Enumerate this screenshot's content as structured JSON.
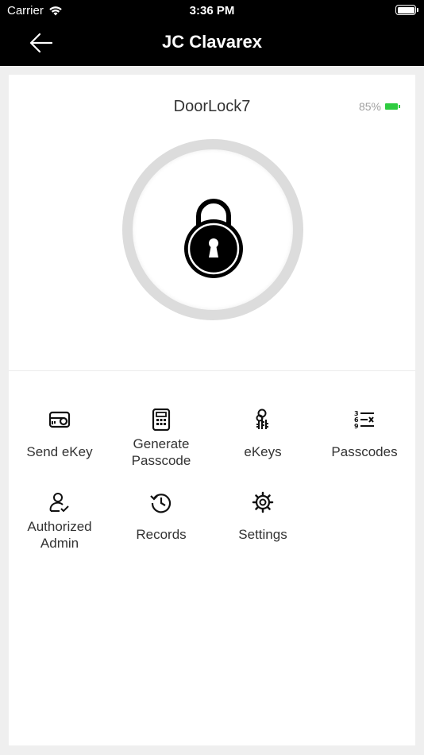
{
  "status_bar": {
    "carrier": "Carrier",
    "time": "3:36 PM"
  },
  "header": {
    "title": "JC Clavarex"
  },
  "lock": {
    "name": "DoorLock7",
    "battery": "85%",
    "battery_color": "#2ecc40"
  },
  "menu": [
    {
      "label": "Send eKey",
      "icon": "send-ekey-icon"
    },
    {
      "label": "Generate\nPasscode",
      "icon": "calculator-icon"
    },
    {
      "label": "eKeys",
      "icon": "keys-icon"
    },
    {
      "label": "Passcodes",
      "icon": "passcode-list-icon"
    },
    {
      "label": "Authorized\nAdmin",
      "icon": "user-check-icon"
    },
    {
      "label": "Records",
      "icon": "history-icon"
    },
    {
      "label": "Settings",
      "icon": "gear-icon"
    }
  ]
}
